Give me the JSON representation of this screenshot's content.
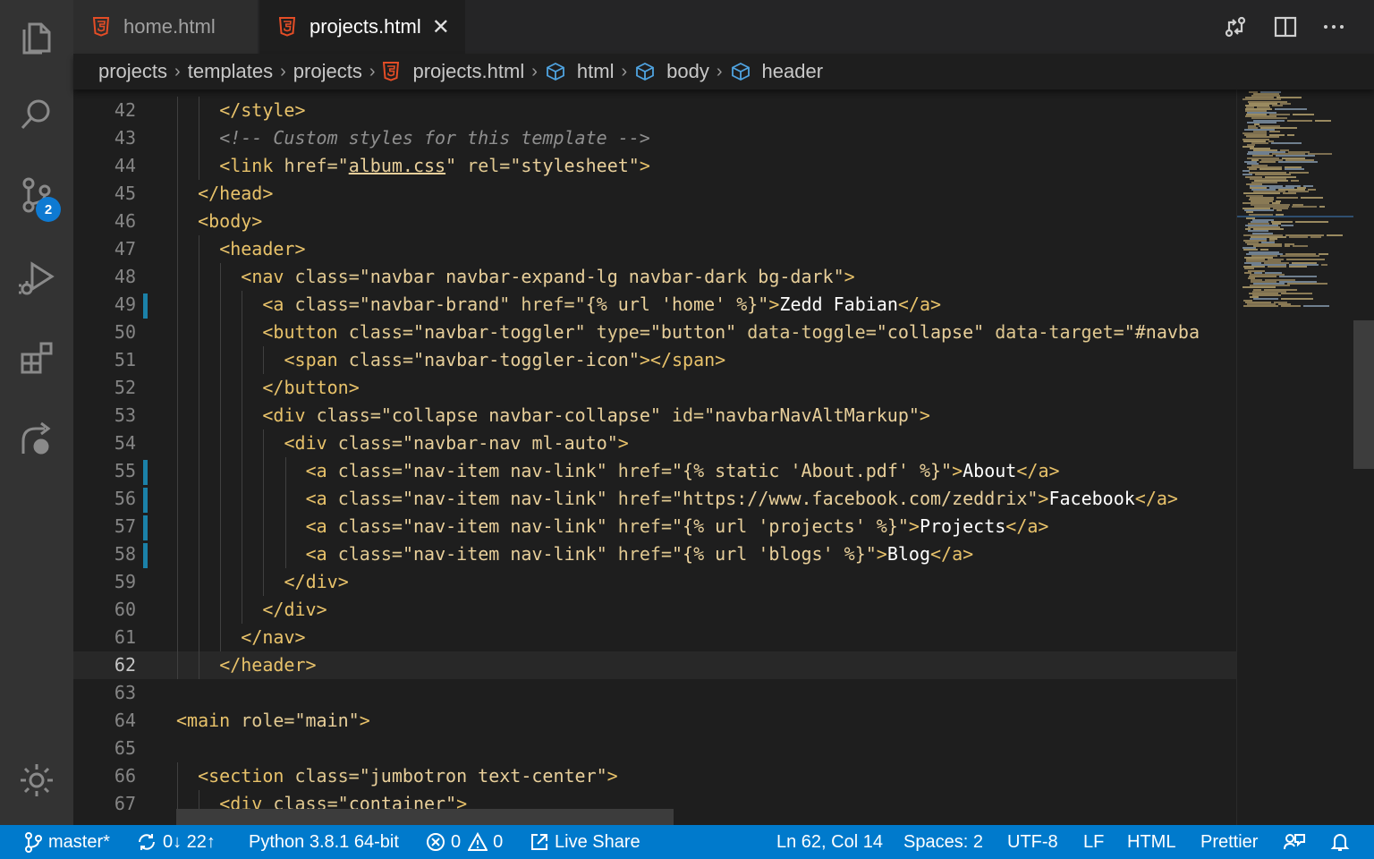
{
  "tabs": [
    {
      "label": "home.html",
      "active": false
    },
    {
      "label": "projects.html",
      "active": true
    }
  ],
  "tab_close_glyph": "✕",
  "breadcrumb": [
    "projects",
    "templates",
    "projects",
    "projects.html",
    "html",
    "body",
    "header"
  ],
  "source_control_badge": "2",
  "editor": {
    "current_line": 62,
    "lines": [
      {
        "n": "42",
        "indent": 2,
        "tokens": [
          [
            "tag",
            "</style>"
          ]
        ]
      },
      {
        "n": "43",
        "indent": 2,
        "tokens": [
          [
            "cmt",
            "<!-- Custom styles for this template -->"
          ]
        ]
      },
      {
        "n": "44",
        "indent": 2,
        "tokens": [
          [
            "tag",
            "<link "
          ],
          [
            "attr",
            "href="
          ],
          [
            "str",
            "\""
          ],
          [
            "str ul",
            "album.css"
          ],
          [
            "str",
            "\" "
          ],
          [
            "attr",
            "rel="
          ],
          [
            "str",
            "\"stylesheet\""
          ],
          [
            "tag",
            ">"
          ]
        ]
      },
      {
        "n": "45",
        "indent": 1,
        "tokens": [
          [
            "tag",
            "</head>"
          ]
        ]
      },
      {
        "n": "46",
        "indent": 1,
        "tokens": [
          [
            "tag",
            "<body>"
          ]
        ]
      },
      {
        "n": "47",
        "indent": 2,
        "tokens": [
          [
            "tag",
            "<header>"
          ]
        ]
      },
      {
        "n": "48",
        "indent": 3,
        "tokens": [
          [
            "tag",
            "<nav "
          ],
          [
            "attr",
            "class="
          ],
          [
            "str",
            "\"navbar navbar-expand-lg navbar-dark bg-dark\""
          ],
          [
            "tag",
            ">"
          ]
        ]
      },
      {
        "n": "49",
        "indent": 4,
        "mod": true,
        "tokens": [
          [
            "tag",
            "<a "
          ],
          [
            "attr",
            "class="
          ],
          [
            "str",
            "\"navbar-brand\" "
          ],
          [
            "attr",
            "href="
          ],
          [
            "str",
            "\"{% url 'home' %}\""
          ],
          [
            "tag",
            ">"
          ],
          [
            "txt",
            "Zedd Fabian"
          ],
          [
            "tag",
            "</a>"
          ]
        ]
      },
      {
        "n": "50",
        "indent": 4,
        "tokens": [
          [
            "tag",
            "<button "
          ],
          [
            "attr",
            "class="
          ],
          [
            "str",
            "\"navbar-toggler\" "
          ],
          [
            "attr",
            "type="
          ],
          [
            "str",
            "\"button\" "
          ],
          [
            "attr",
            "data-toggle="
          ],
          [
            "str",
            "\"collapse\" "
          ],
          [
            "attr",
            "data-target="
          ],
          [
            "str",
            "\"#navba"
          ]
        ]
      },
      {
        "n": "51",
        "indent": 5,
        "tokens": [
          [
            "tag",
            "<span "
          ],
          [
            "attr",
            "class="
          ],
          [
            "str",
            "\"navbar-toggler-icon\""
          ],
          [
            "tag",
            "></span>"
          ]
        ]
      },
      {
        "n": "52",
        "indent": 4,
        "tokens": [
          [
            "tag",
            "</button>"
          ]
        ]
      },
      {
        "n": "53",
        "indent": 4,
        "tokens": [
          [
            "tag",
            "<div "
          ],
          [
            "attr",
            "class="
          ],
          [
            "str",
            "\"collapse navbar-collapse\" "
          ],
          [
            "attr",
            "id="
          ],
          [
            "str",
            "\"navbarNavAltMarkup\""
          ],
          [
            "tag",
            ">"
          ]
        ]
      },
      {
        "n": "54",
        "indent": 5,
        "tokens": [
          [
            "tag",
            "<div "
          ],
          [
            "attr",
            "class="
          ],
          [
            "str",
            "\"navbar-nav ml-auto\""
          ],
          [
            "tag",
            ">"
          ]
        ]
      },
      {
        "n": "55",
        "indent": 6,
        "mod": true,
        "tokens": [
          [
            "tag",
            "<a "
          ],
          [
            "attr",
            "class="
          ],
          [
            "str",
            "\"nav-item nav-link\" "
          ],
          [
            "attr",
            "href="
          ],
          [
            "str",
            "\"{% static 'About.pdf' %}\""
          ],
          [
            "tag",
            ">"
          ],
          [
            "txt",
            "About"
          ],
          [
            "tag",
            "</a>"
          ]
        ]
      },
      {
        "n": "56",
        "indent": 6,
        "mod": true,
        "tokens": [
          [
            "tag",
            "<a "
          ],
          [
            "attr",
            "class="
          ],
          [
            "str",
            "\"nav-item nav-link\" "
          ],
          [
            "attr",
            "href="
          ],
          [
            "str",
            "\"https://www.facebook.com/zeddrix\""
          ],
          [
            "tag",
            ">"
          ],
          [
            "txt",
            "Facebook"
          ],
          [
            "tag",
            "</a>"
          ]
        ]
      },
      {
        "n": "57",
        "indent": 6,
        "mod": true,
        "tokens": [
          [
            "tag",
            "<a "
          ],
          [
            "attr",
            "class="
          ],
          [
            "str",
            "\"nav-item nav-link\" "
          ],
          [
            "attr",
            "href="
          ],
          [
            "str",
            "\"{% url 'projects' %}\""
          ],
          [
            "tag",
            ">"
          ],
          [
            "txt",
            "Projects"
          ],
          [
            "tag",
            "</a>"
          ]
        ]
      },
      {
        "n": "58",
        "indent": 6,
        "mod": true,
        "tokens": [
          [
            "tag",
            "<a "
          ],
          [
            "attr",
            "class="
          ],
          [
            "str",
            "\"nav-item nav-link\" "
          ],
          [
            "attr",
            "href="
          ],
          [
            "str",
            "\"{% url 'blogs' %}\""
          ],
          [
            "tag",
            ">"
          ],
          [
            "txt",
            "Blog"
          ],
          [
            "tag",
            "</a>"
          ]
        ]
      },
      {
        "n": "59",
        "indent": 5,
        "tokens": [
          [
            "tag",
            "</div>"
          ]
        ]
      },
      {
        "n": "60",
        "indent": 4,
        "tokens": [
          [
            "tag",
            "</div>"
          ]
        ]
      },
      {
        "n": "61",
        "indent": 3,
        "tokens": [
          [
            "tag",
            "</nav>"
          ]
        ]
      },
      {
        "n": "62",
        "indent": 2,
        "tokens": [
          [
            "tag",
            "</header>"
          ]
        ]
      },
      {
        "n": "63",
        "indent": 0,
        "tokens": []
      },
      {
        "n": "64",
        "indent": 0,
        "tokens": [
          [
            "tag",
            "<main "
          ],
          [
            "attr",
            "role="
          ],
          [
            "str",
            "\"main\""
          ],
          [
            "tag",
            ">"
          ]
        ]
      },
      {
        "n": "65",
        "indent": 0,
        "tokens": []
      },
      {
        "n": "66",
        "indent": 1,
        "tokens": [
          [
            "tag",
            "<section "
          ],
          [
            "attr",
            "class="
          ],
          [
            "str",
            "\"jumbotron text-center\""
          ],
          [
            "tag",
            ">"
          ]
        ]
      },
      {
        "n": "67",
        "indent": 2,
        "tokens": [
          [
            "tag",
            "<div "
          ],
          [
            "attr",
            "class="
          ],
          [
            "str",
            "\"container\""
          ],
          [
            "tag",
            ">"
          ]
        ]
      }
    ]
  },
  "statusbar": {
    "branch": "master*",
    "sync": "0↓ 22↑",
    "python": "Python 3.8.1 64-bit",
    "errors": "0",
    "warnings": "0",
    "live_share": "Live Share",
    "position": "Ln 62, Col 14",
    "spaces": "Spaces: 2",
    "encoding": "UTF-8",
    "eol": "LF",
    "language": "HTML",
    "formatter": "Prettier"
  },
  "colors": {
    "accent": "#007acc",
    "tag": "#e8c26a",
    "attribute": "#e0c890",
    "string": "#e8cf9a",
    "comment": "#8f8f8f",
    "modified_gutter": "#1b81a8"
  }
}
